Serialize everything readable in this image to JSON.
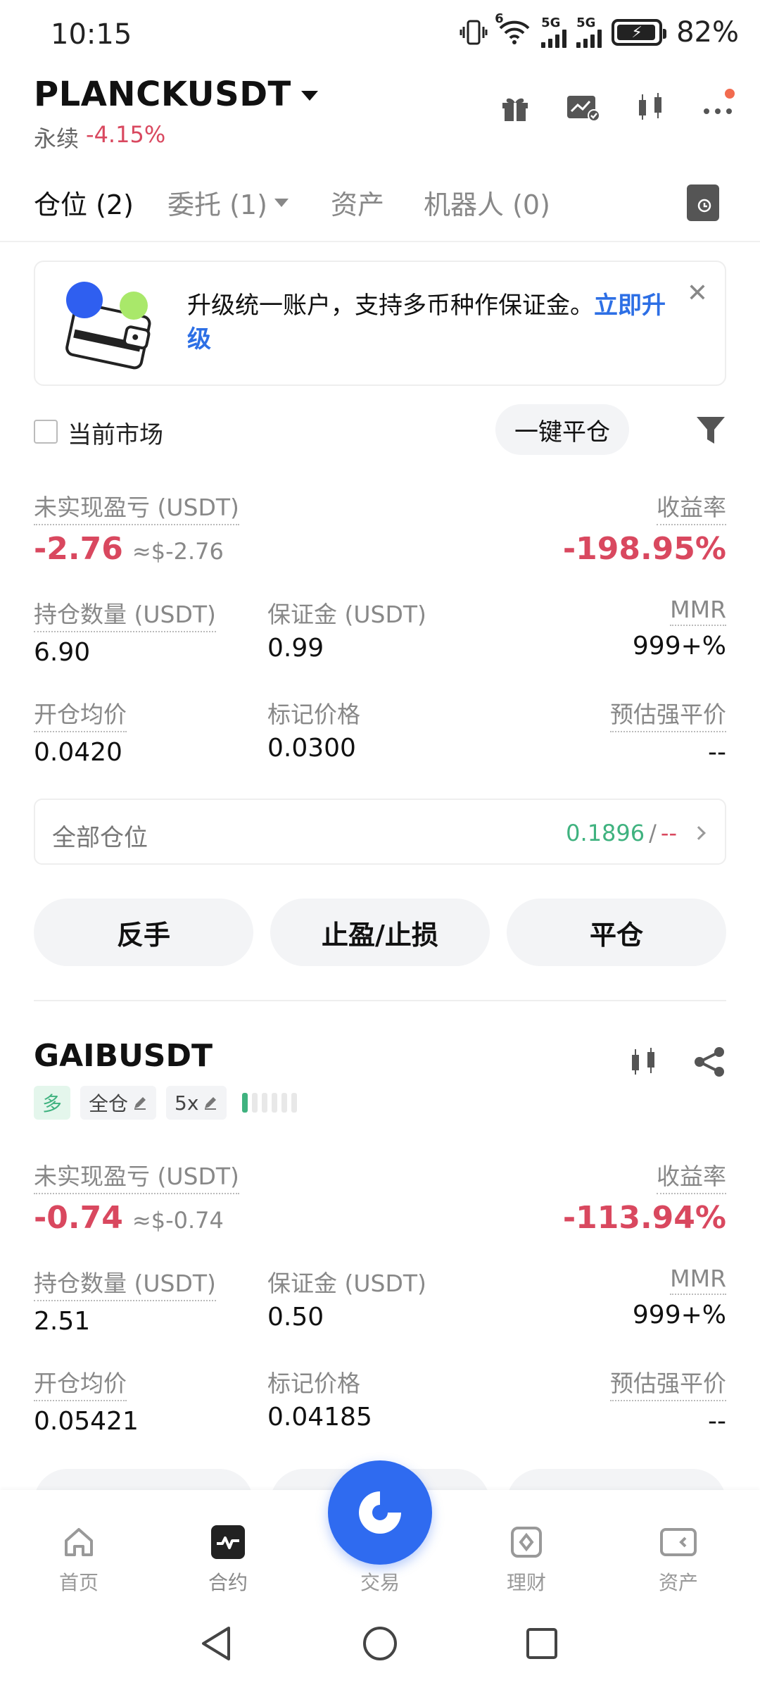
{
  "status_bar": {
    "time": "10:15",
    "network_1": "5G",
    "network_2": "5G",
    "wifi_badge": "6",
    "battery": "82%"
  },
  "header": {
    "symbol": "PLANCKUSDT",
    "contract_type": "永续",
    "change": "-4.15%",
    "icons": [
      "gift-icon",
      "chart-check-icon",
      "candlestick-icon",
      "more-icon"
    ]
  },
  "tabs": [
    {
      "label": "仓位 (2)",
      "active": true
    },
    {
      "label": "委托 (1)",
      "active": false
    },
    {
      "label": "资产",
      "active": false
    },
    {
      "label": "机器人 (0)",
      "active": false
    }
  ],
  "banner": {
    "text": "升级统一账户，支持多币种作保证金。",
    "link": "立即升级"
  },
  "filter": {
    "checkbox_label": "当前市场",
    "close_all": "一键平仓"
  },
  "positions": [
    {
      "unrealized_label": "未实现盈亏 (USDT)",
      "unrealized": "-2.76",
      "unrealized_usd": "≈$-2.76",
      "roe_label": "收益率",
      "roe": "-198.95%",
      "size_label": "持仓数量 (USDT)",
      "size": "6.90",
      "margin_label": "保证金 (USDT)",
      "margin": "0.99",
      "mmr_label": "MMR",
      "mmr": "999+%",
      "entry_label": "开仓均价",
      "entry": "0.0420",
      "mark_label": "标记价格",
      "mark": "0.0300",
      "liq_label": "预估强平价",
      "liq": "--",
      "all_positions_label": "全部仓位",
      "all_positions_value": "0.1896",
      "all_positions_sep": "/",
      "all_positions_extra": "--",
      "buttons": [
        "反手",
        "止盈/止损",
        "平仓"
      ]
    },
    {
      "symbol": "GAIBUSDT",
      "side": "多",
      "margin_mode": "全仓",
      "leverage": "5x",
      "unrealized_label": "未实现盈亏 (USDT)",
      "unrealized": "-0.74",
      "unrealized_usd": "≈$-0.74",
      "roe_label": "收益率",
      "roe": "-113.94%",
      "size_label": "持仓数量 (USDT)",
      "size": "2.51",
      "margin_label": "保证金 (USDT)",
      "margin": "0.50",
      "mmr_label": "MMR",
      "mmr": "999+%",
      "entry_label": "开仓均价",
      "entry": "0.05421",
      "mark_label": "标记价格",
      "mark": "0.04185",
      "liq_label": "预估强平价",
      "liq": "--"
    }
  ],
  "bottom_nav": [
    {
      "label": "首页",
      "icon": "home-icon"
    },
    {
      "label": "合约",
      "icon": "futures-icon",
      "active": true
    },
    {
      "label": "交易",
      "icon": "trade-icon"
    },
    {
      "label": "理财",
      "icon": "earn-icon"
    },
    {
      "label": "资产",
      "icon": "assets-icon"
    }
  ],
  "colors": {
    "negative": "#d9485f",
    "positive": "#3fb27f",
    "link": "#2d6fe5",
    "brand": "#2f6bf0"
  }
}
